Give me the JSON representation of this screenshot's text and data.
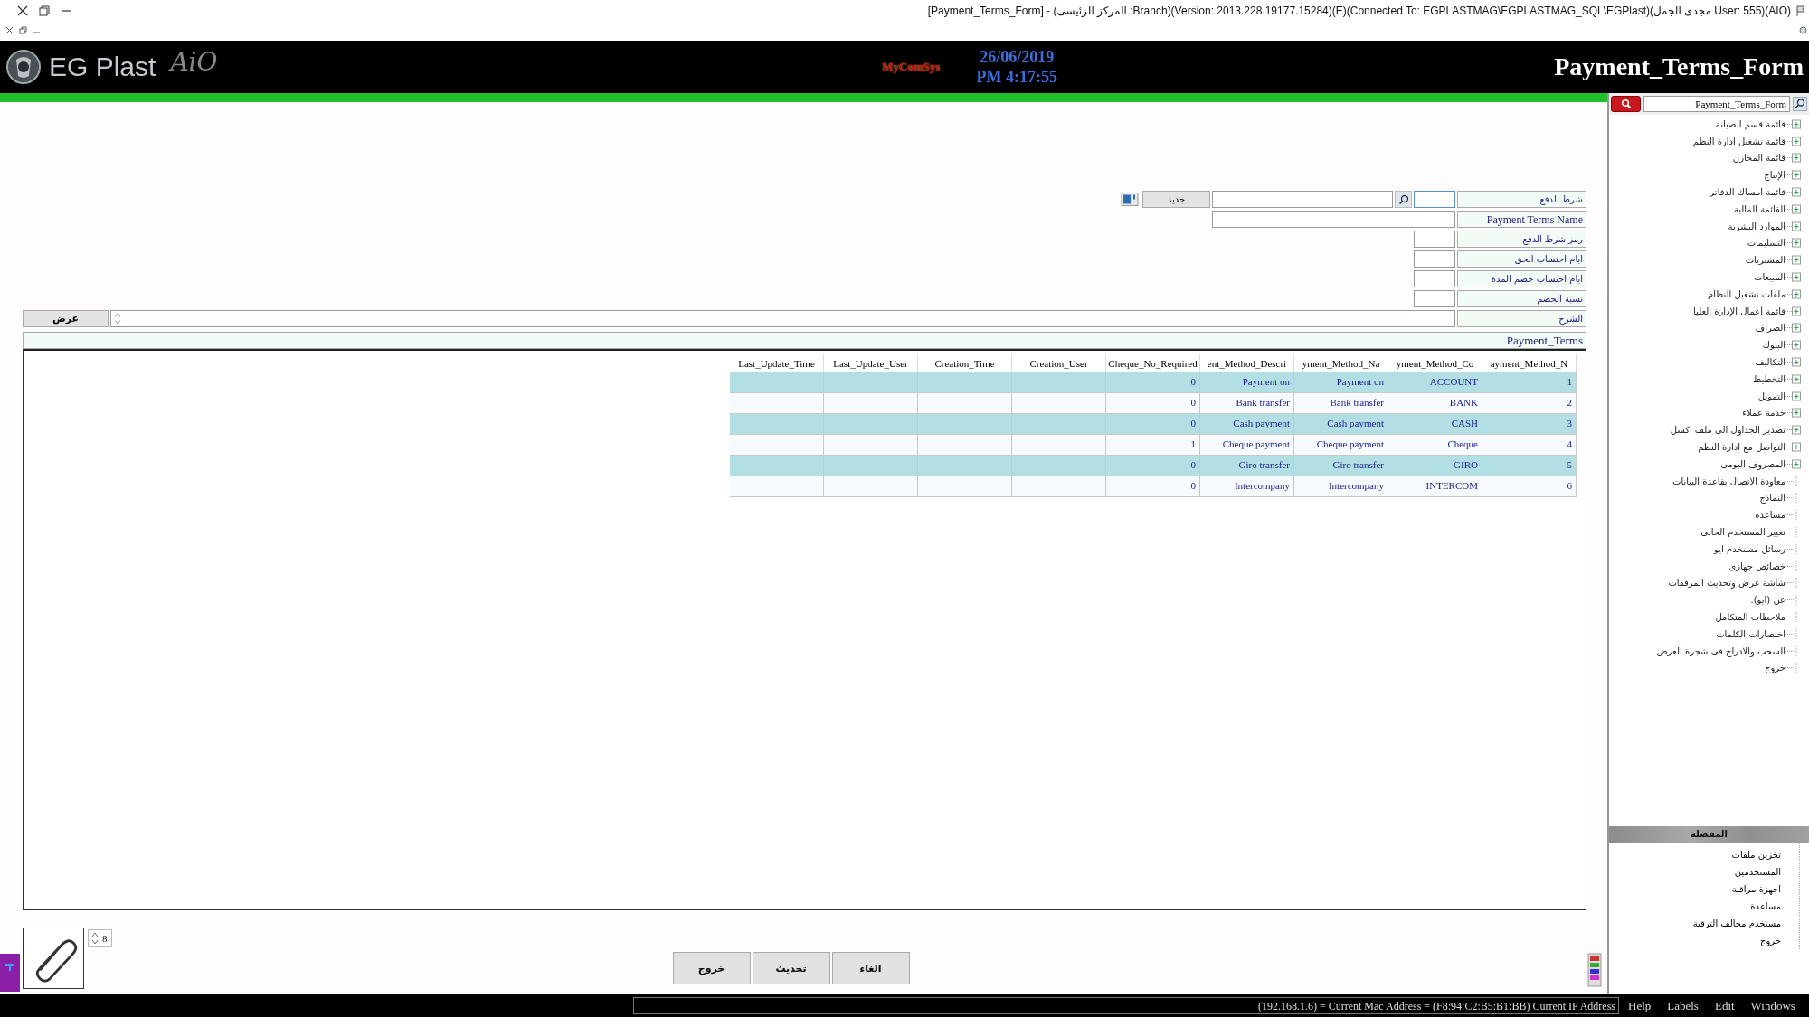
{
  "window": {
    "title": "[Payment_Terms_Form] - (المركز الرئيسى :Branch)(Version: 2013.228.19177.15284)(E)(Connected To: EGPLASTMAG\\EGPLASTMAG_SQL\\EGPlast)(مجدى الجمل User: 555)(AIO)"
  },
  "header": {
    "brand": "EG Plast",
    "brand_tag": "AiO",
    "vendor": "MyComSys",
    "date": "26/06/2019",
    "time": "PM 4:17:55",
    "form_title": "Payment_Terms_Form"
  },
  "form": {
    "new_button": "جديد",
    "view_button": "عرض",
    "rows": [
      {
        "label": "شرط الدفع",
        "kind": "lookup"
      },
      {
        "label": "Payment Terms Name",
        "kind": "wide"
      },
      {
        "label": "رمز شرط الدفع",
        "kind": "small"
      },
      {
        "label": "ايام احتساب الحق",
        "kind": "small"
      },
      {
        "label": "ايام احتساب خصم المدة",
        "kind": "small"
      },
      {
        "label": "نسبة الخصم",
        "kind": "small"
      },
      {
        "label": "الشرح",
        "kind": "memo"
      }
    ]
  },
  "table": {
    "title": "Payment_Terms",
    "columns": [
      "ayment_Method_N",
      "yment_Method_Co",
      "yment_Method_Na",
      "ent_Method_Descri",
      "Cheque_No_Required",
      "Creation_User",
      "Creation_Time",
      "Last_Update_User",
      "Last_Update_Time"
    ],
    "rows": [
      [
        "1",
        "ACCOUNT",
        "Payment on",
        "Payment on",
        "0"
      ],
      [
        "2",
        "BANK",
        "Bank transfer",
        "Bank transfer",
        "0"
      ],
      [
        "3",
        "CASH",
        "Cash payment",
        "Cash payment",
        "0"
      ],
      [
        "4",
        "Cheque",
        "Cheque payment",
        "Cheque payment",
        "1"
      ],
      [
        "5",
        "GIRO",
        "Giro transfer",
        "Giro transfer",
        "0"
      ],
      [
        "6",
        "INTERCOM",
        "Intercompany",
        "Intercompany",
        "0"
      ]
    ]
  },
  "bottom": {
    "attachment_count": "8",
    "buttons": [
      "الغاء",
      "تحديث",
      "خروج"
    ]
  },
  "sidebar": {
    "search_value": "Payment_Terms_Form",
    "items": [
      {
        "label": "قائمة قسم الصيانة",
        "kind": "folder"
      },
      {
        "label": "قائمة تشغيل ادارة النظم",
        "kind": "folder"
      },
      {
        "label": "قائمة المخازن",
        "kind": "folder"
      },
      {
        "label": "الإنتاج",
        "kind": "folder"
      },
      {
        "label": "قائمة امساك الدفاتر",
        "kind": "folder"
      },
      {
        "label": "القائمة المالية",
        "kind": "folder"
      },
      {
        "label": "الموارد البشرية",
        "kind": "folder"
      },
      {
        "label": "التسليمات",
        "kind": "folder"
      },
      {
        "label": "المشتريات",
        "kind": "folder"
      },
      {
        "label": "المبيعات",
        "kind": "folder"
      },
      {
        "label": "ملفات تشغيل النظام",
        "kind": "folder"
      },
      {
        "label": "قائمة أعمال الإدارة العليا",
        "kind": "folder"
      },
      {
        "label": "الصراف",
        "kind": "folder"
      },
      {
        "label": "البنوك",
        "kind": "folder"
      },
      {
        "label": "التكاليف",
        "kind": "folder"
      },
      {
        "label": "التخطيط",
        "kind": "folder"
      },
      {
        "label": "التمويل",
        "kind": "folder"
      },
      {
        "label": "خدمة عملاء",
        "kind": "folder"
      },
      {
        "label": "تصدير الجداول الى ملف اكسل",
        "kind": "folder"
      },
      {
        "label": "التواصل مع ادارة النظم",
        "kind": "folder"
      },
      {
        "label": "المصروف اليومى",
        "kind": "folder"
      },
      {
        "label": "معاودة الاتصال بقاعدة البيانات",
        "kind": "leaf"
      },
      {
        "label": "النماذج",
        "kind": "leaf"
      },
      {
        "label": "مساعدة",
        "kind": "leaf"
      },
      {
        "label": "تغيير المستخدم الحالى",
        "kind": "leaf"
      },
      {
        "label": "رسائل مستخدم ايو",
        "kind": "leaf"
      },
      {
        "label": "خصائص جهازى",
        "kind": "leaf"
      },
      {
        "label": "شاشة عرض وتحديث المرفقات",
        "kind": "leaf"
      },
      {
        "label": "عن (ايو).",
        "kind": "leaf"
      },
      {
        "label": "ملاحظات المتكامل",
        "kind": "leaf"
      },
      {
        "label": "اختصارات الكلمات",
        "kind": "leaf"
      },
      {
        "label": "السحب والادراج فى شجرة العرض",
        "kind": "leaf"
      },
      {
        "label": "خروج",
        "kind": "leaf"
      }
    ],
    "favorites_title": "المفضلة",
    "favorites": [
      "تخزين ملفات",
      "المستخدمين",
      "اجهزة مراقبة",
      "مساعدة",
      "مستخدم مخالف الترقية",
      "خروج"
    ]
  },
  "status_bar": {
    "info": "(192.168.1.6) = Current Mac Address = (F8:94:C2:B5:B1:BB) Current IP Address",
    "menu": [
      "Windows",
      "Edit",
      "Labels",
      "Help"
    ]
  }
}
